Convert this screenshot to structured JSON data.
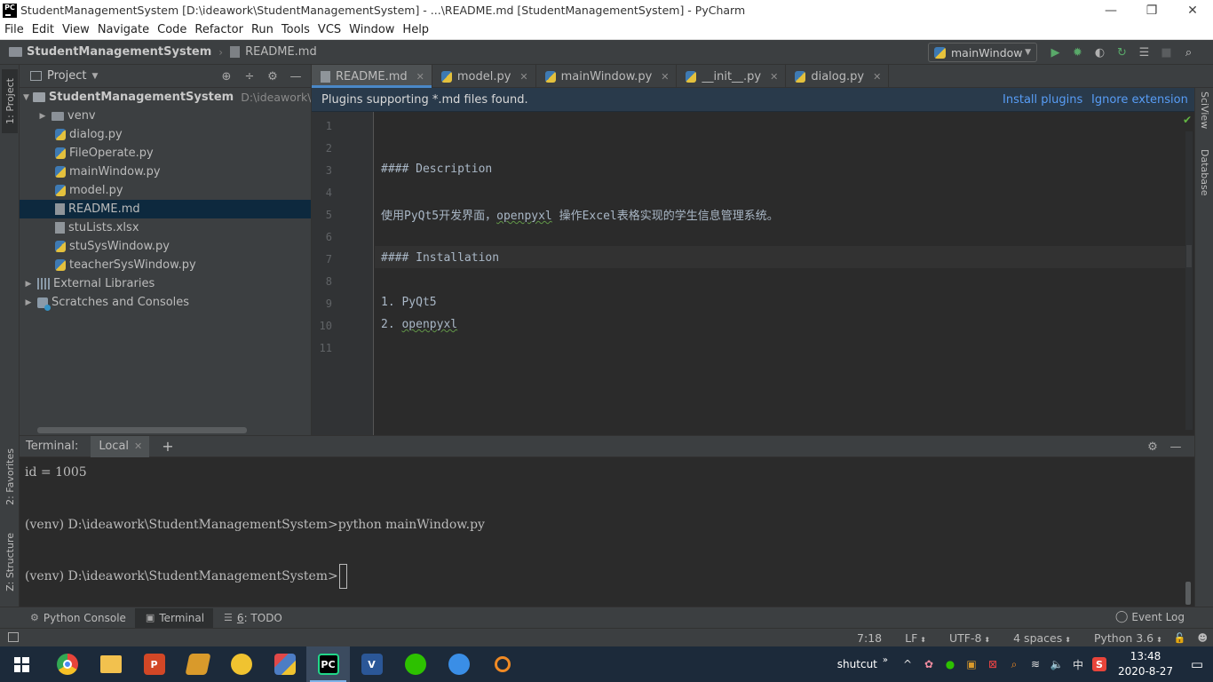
{
  "window": {
    "title": "StudentManagementSystem [D:\\ideawork\\StudentManagementSystem] - ...\\README.md [StudentManagementSystem] - PyCharm",
    "logo_text": "PC",
    "minimize": "—",
    "restore": "❐",
    "close": "✕"
  },
  "menu": [
    "File",
    "Edit",
    "View",
    "Navigate",
    "Code",
    "Refactor",
    "Run",
    "Tools",
    "VCS",
    "Window",
    "Help"
  ],
  "navbar": {
    "project": "StudentManagementSystem",
    "separator": "›",
    "file": "README.md",
    "run_config": "mainWindow",
    "run_config_arrow": "▼",
    "tools": [
      "▶",
      "✹",
      "◐",
      "↻",
      "☰",
      "■",
      "⌕"
    ]
  },
  "left_stripe": {
    "project_tab": "1: Project",
    "favorites_tab": "2: Favorites",
    "structure_tab": "Z: Structure"
  },
  "project_panel": {
    "title": "Project",
    "arrow": "▼",
    "tools": [
      "⊕",
      "÷",
      "⚙",
      "—"
    ],
    "tree": [
      {
        "label": "StudentManagementSystem",
        "path": "D:\\ideawork\\StudentManagementSystem",
        "chevron": "▼",
        "icon": "folder-icon",
        "bold": true
      },
      {
        "label": "venv",
        "chevron": "▶",
        "icon": "folder-icon"
      },
      {
        "label": "dialog.py",
        "icon": "python-file-icon"
      },
      {
        "label": "FileOperate.py",
        "icon": "python-file-icon"
      },
      {
        "label": "mainWindow.py",
        "icon": "python-file-icon"
      },
      {
        "label": "model.py",
        "icon": "python-file-icon"
      },
      {
        "label": "README.md",
        "icon": "markdown-file-icon",
        "selected": true
      },
      {
        "label": "stuLists.xlsx",
        "icon": "spreadsheet-file-icon"
      },
      {
        "label": "stuSysWindow.py",
        "icon": "python-file-icon"
      },
      {
        "label": "teacherSysWindow.py",
        "icon": "python-file-icon"
      },
      {
        "label": "External Libraries",
        "chevron": "▶",
        "icon": "library-icon"
      },
      {
        "label": "Scratches and Consoles",
        "chevron": "▶",
        "icon": "scratches-icon"
      }
    ]
  },
  "editor_tabs": [
    {
      "label": "README.md",
      "active": true
    },
    {
      "label": "model.py"
    },
    {
      "label": "mainWindow.py"
    },
    {
      "label": "__init__.py"
    },
    {
      "label": "dialog.py"
    }
  ],
  "tab_close": "✕",
  "banner": {
    "message": "Plugins supporting *.md files found.",
    "install": "Install plugins",
    "ignore": "Ignore extension"
  },
  "editor": {
    "line_numbers": [
      "1",
      "2",
      "3",
      "4",
      "5",
      "6",
      "7",
      "8",
      "9",
      "10",
      "11"
    ],
    "lines": {
      "l3": "#### Description",
      "l5_a": "使用PyQt5开发界面，",
      "l5_b": "openpyxl",
      "l5_c": " 操作Excel表格实现的学生信息管理系统。",
      "l7": "#### Installation",
      "l9": "1. PyQt5",
      "l10_a": "2. ",
      "l10_b": "openpyxl"
    },
    "check": "✔"
  },
  "right_stripe": {
    "sciview": "SciView",
    "database": "Database"
  },
  "terminal": {
    "title": "Terminal:",
    "tab": "Local",
    "add": "+",
    "tools": [
      "⚙",
      "—"
    ],
    "lines": [
      "id =  1005",
      "(venv) D:\\ideawork\\StudentManagementSystem>python mainWindow.py",
      "(venv) D:\\ideawork\\StudentManagementSystem>"
    ]
  },
  "bottom_tools": {
    "python_console": "Python Console",
    "terminal": "Terminal",
    "todo_num": "6",
    "todo_label": ": TODO",
    "event_log": "Event Log"
  },
  "status": {
    "position": "7:18",
    "line_sep": "LF",
    "encoding": "UTF-8",
    "indent": "4 spaces",
    "interpreter": "Python 3.6",
    "dd": "⬍"
  },
  "taskbar": {
    "apps": [
      {
        "name": "chrome",
        "glyph": "",
        "color": "#e8443a"
      },
      {
        "name": "file-explorer",
        "glyph": "",
        "color": "#f2c14e"
      },
      {
        "name": "powerpoint",
        "glyph": "P",
        "color": "#d24726"
      },
      {
        "name": "notebook",
        "glyph": "",
        "color": "#d99a2b"
      },
      {
        "name": "tortoise",
        "glyph": "",
        "color": "#f0c330"
      },
      {
        "name": "typora",
        "glyph": "",
        "color": "#4d7dc4"
      },
      {
        "name": "pycharm",
        "glyph": "PC",
        "color": "#1e1e1e",
        "active": true
      },
      {
        "name": "visio",
        "glyph": "V",
        "color": "#2b5797"
      },
      {
        "name": "wechat",
        "glyph": "",
        "color": "#2dc100"
      },
      {
        "name": "feishu",
        "glyph": "",
        "color": "#3a8ee6"
      },
      {
        "name": "search-tool",
        "glyph": "",
        "color": "#f08a24"
      }
    ],
    "tray_label": "shutcut",
    "tray_chevron": "»",
    "tray_icons": [
      "^",
      "✿",
      "●",
      "▣",
      "⊠",
      "⌕",
      "≋",
      "🔈",
      "中",
      "S"
    ],
    "time": "13:48",
    "date": "2020-8-27",
    "notification": "▭"
  }
}
